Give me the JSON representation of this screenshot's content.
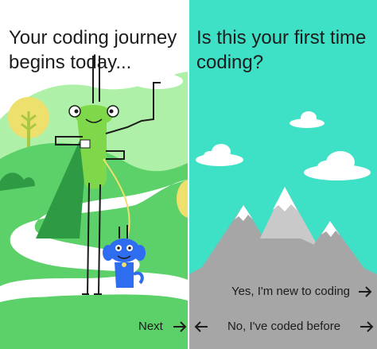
{
  "screens": [
    {
      "title": "Your coding journey begins today...",
      "next_label": "Next",
      "next_icon": "arrow-right-icon"
    },
    {
      "title": "Is this your first time coding?",
      "options": [
        {
          "label": "Yes, I'm new to coding",
          "icon": "arrow-right-icon"
        },
        {
          "label": "No, I've coded before",
          "icon": "arrow-left-icon"
        }
      ]
    }
  ],
  "colors": {
    "left_sky": "#ffffff",
    "hills_light": "#aff0a8",
    "hills_mid": "#5cd16a",
    "grasshopper_body": "#7fd84a",
    "grasshopper_wing": "#2f9a44",
    "dog": "#2f6df0",
    "right_sky": "#3ee0c6",
    "mountain_gray": "#a6a6a6",
    "snow": "#ffffff"
  }
}
